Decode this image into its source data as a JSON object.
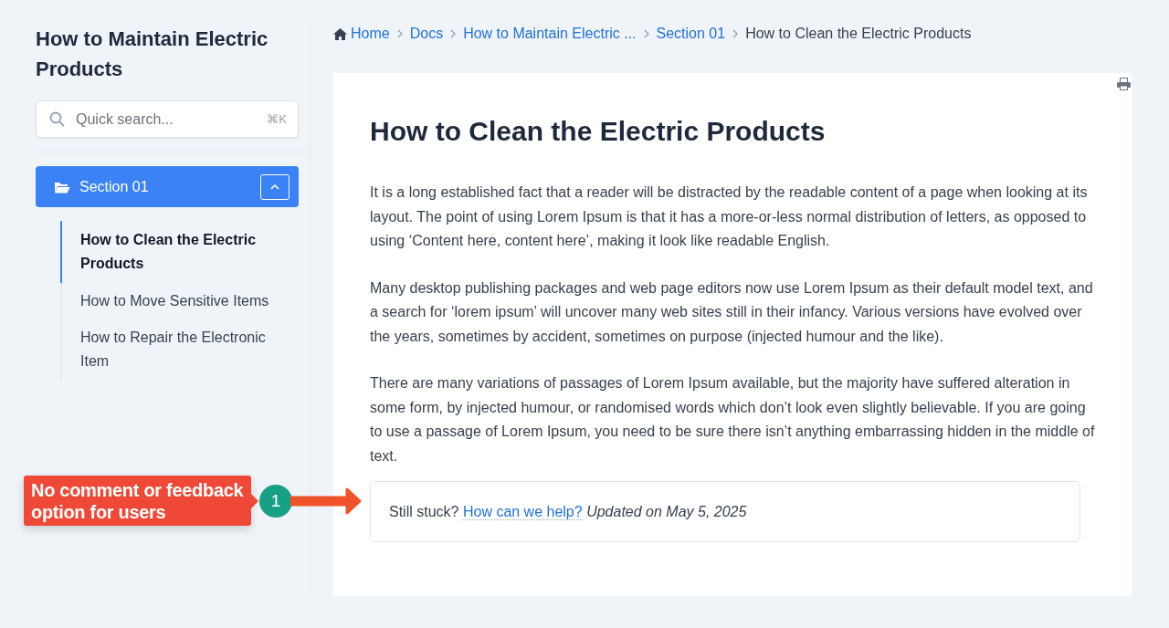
{
  "sidebar": {
    "title": "How to Maintain Electric Products",
    "search": {
      "placeholder": "Quick search...",
      "shortcut": "⌘K"
    },
    "section": {
      "label": "Section 01",
      "expanded": true,
      "items": [
        {
          "label": "How to Clean the Electric Products",
          "selected": true
        },
        {
          "label": "How to Move Sensitive Items",
          "selected": false
        },
        {
          "label": "How to Repair the Electronic Item",
          "selected": false
        }
      ]
    }
  },
  "breadcrumb": [
    {
      "label": "Home",
      "kind": "home"
    },
    {
      "label": "Docs",
      "kind": "link"
    },
    {
      "label": "How to Maintain Electric ...",
      "kind": "link"
    },
    {
      "label": "Section 01",
      "kind": "link"
    },
    {
      "label": "How to Clean the Electric Products",
      "kind": "current"
    }
  ],
  "article": {
    "title": "How to Clean the Electric Products",
    "paragraphs": [
      "It is a long established fact that a reader will be distracted by the readable content of a page when looking at its layout. The point of using Lorem Ipsum is that it has a more-or-less normal distribution of letters, as opposed to using ‘Content here, content here’, making it look like readable English.",
      "Many desktop publishing packages and web page editors now use Lorem Ipsum as their default model text, and a search for ‘lorem ipsum’ will uncover many web sites still in their infancy. Various versions have evolved over the years, sometimes by accident, sometimes on purpose (injected humour and the like).",
      "There are many variations of passages of Lorem Ipsum available, but the majority have suffered alteration in some form, by injected humour, or randomised words which don’t look even slightly believable. If you are going to use a passage of Lorem Ipsum, you need to be sure there isn’t anything embarrassing hidden in the middle of text."
    ],
    "feedback": {
      "prompt": "Still stuck?",
      "link": "How can we help?",
      "updated": "Updated on May 5, 2025"
    }
  },
  "annotation": {
    "text": "No comment or feedback option for users",
    "number": "1"
  }
}
